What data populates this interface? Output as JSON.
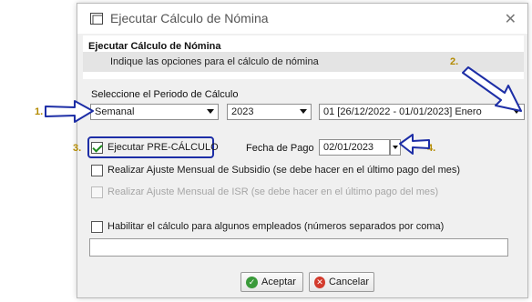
{
  "window": {
    "title": "Ejecutar Cálculo de Nómina"
  },
  "header": {
    "title": "Ejecutar Cálculo de Nómina",
    "subtitle": "Indique las opciones para el cálculo de nómina"
  },
  "period": {
    "label": "Seleccione el Periodo de Cálculo",
    "type_value": "Semanal",
    "year_value": "2023",
    "period_value": "01 [26/12/2022 - 01/01/2023] Enero"
  },
  "options": {
    "pre_calculo": {
      "label": "Ejecutar PRE-CÁLCULO",
      "checked": true
    },
    "fecha_pago_label": "Fecha de Pago",
    "fecha_pago_value": "02/01/2023",
    "ajuste_subsidio": {
      "label": "Realizar Ajuste Mensual de Subsidio (se debe hacer en el último pago del mes)",
      "checked": false
    },
    "ajuste_isr": {
      "label": "Realizar Ajuste Mensual de ISR (se debe hacer en el último pago del mes)",
      "checked": false,
      "disabled": true
    },
    "habilitar_empleados": {
      "label": "Habilitar el cálculo para algunos empleados (números separados por coma)",
      "checked": false
    },
    "empleados_value": ""
  },
  "buttons": {
    "accept": "Aceptar",
    "cancel": "Cancelar"
  },
  "annotations": {
    "step1": "1.",
    "step2": "2.",
    "step3": "3.",
    "step4": "4."
  },
  "colors": {
    "highlight": "#1d2ea6",
    "step_number": "#b38a00",
    "accept_icon": "#3a9a3a",
    "cancel_icon": "#d33a2c"
  }
}
